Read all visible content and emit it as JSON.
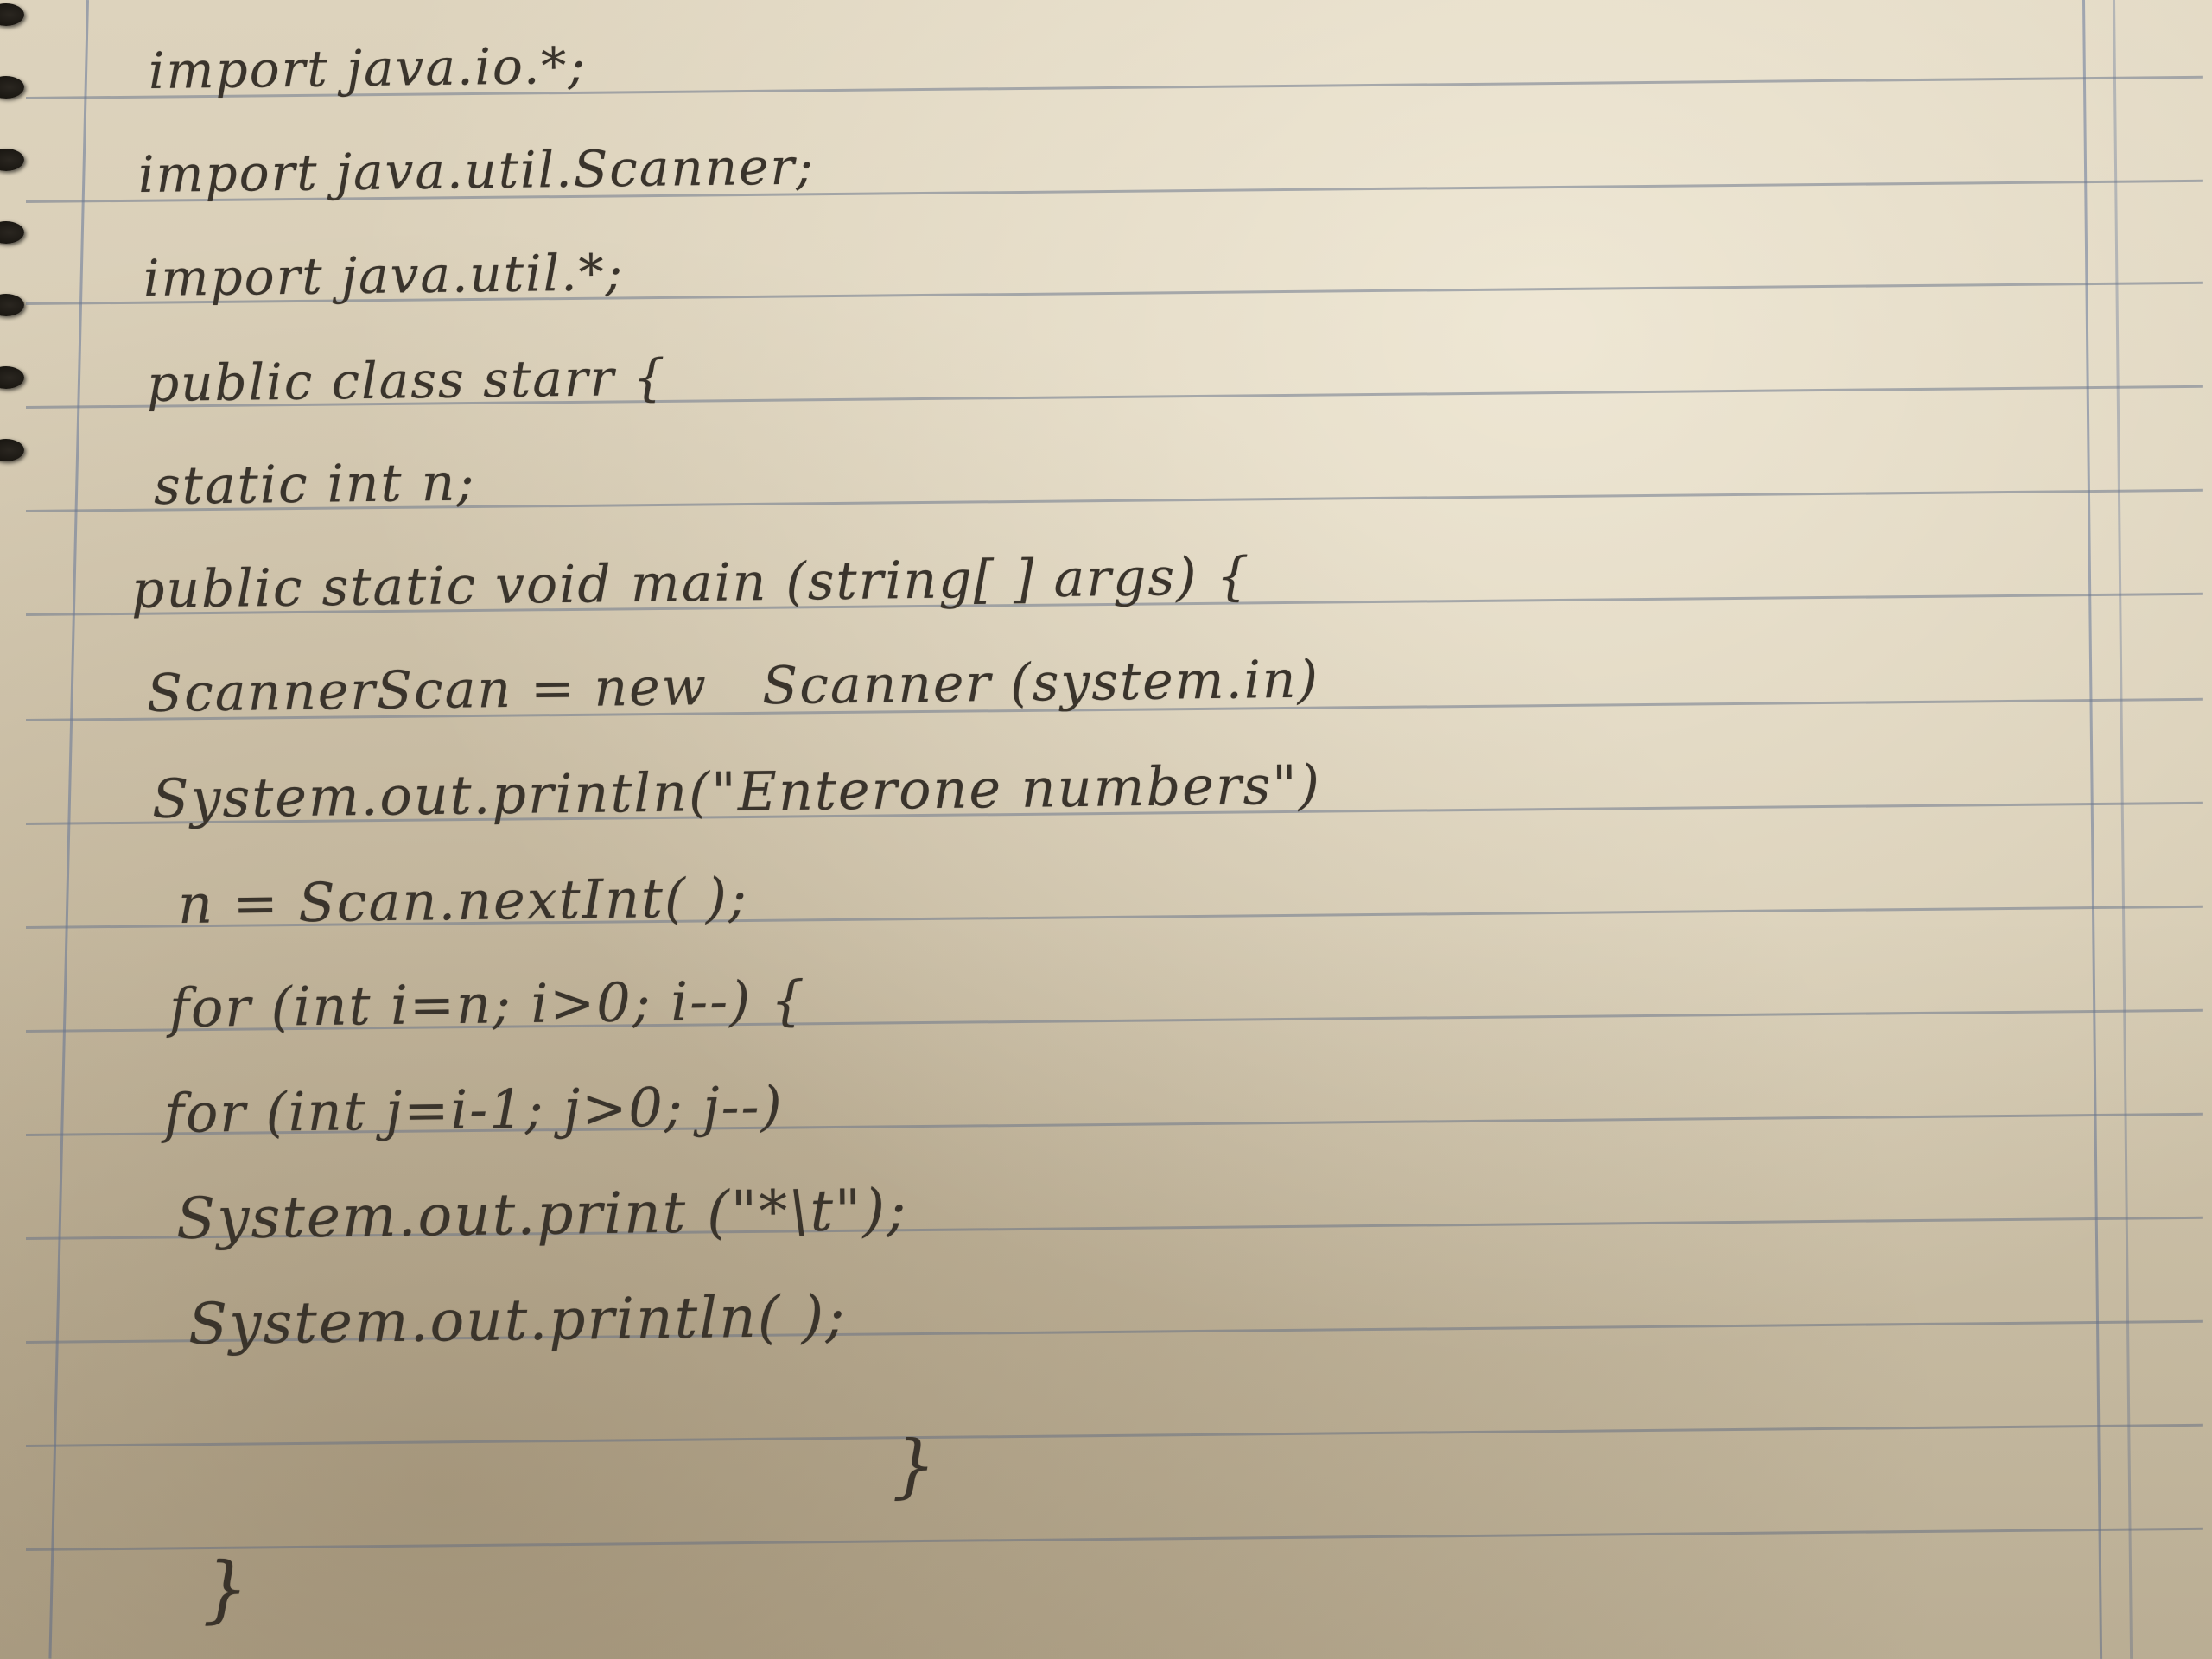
{
  "notebook": {
    "code_lines": [
      "import java.io.*;",
      "import java.util.Scanner;",
      "import java.util.*;",
      "public class starr {",
      "static int n;",
      "public static void main (string[ ] args) {",
      "ScannerScan = new   Scanner (system.in)",
      "System.out.println(\"Enterone numbers\")",
      "n = Scan.nextInt( );",
      "for (int i=n; i>0; i--) {",
      "for (int j=i-1; j>0; j--)",
      "System.out.print (\"*\\t\");",
      "System.out.println( );",
      "}",
      "}"
    ]
  }
}
